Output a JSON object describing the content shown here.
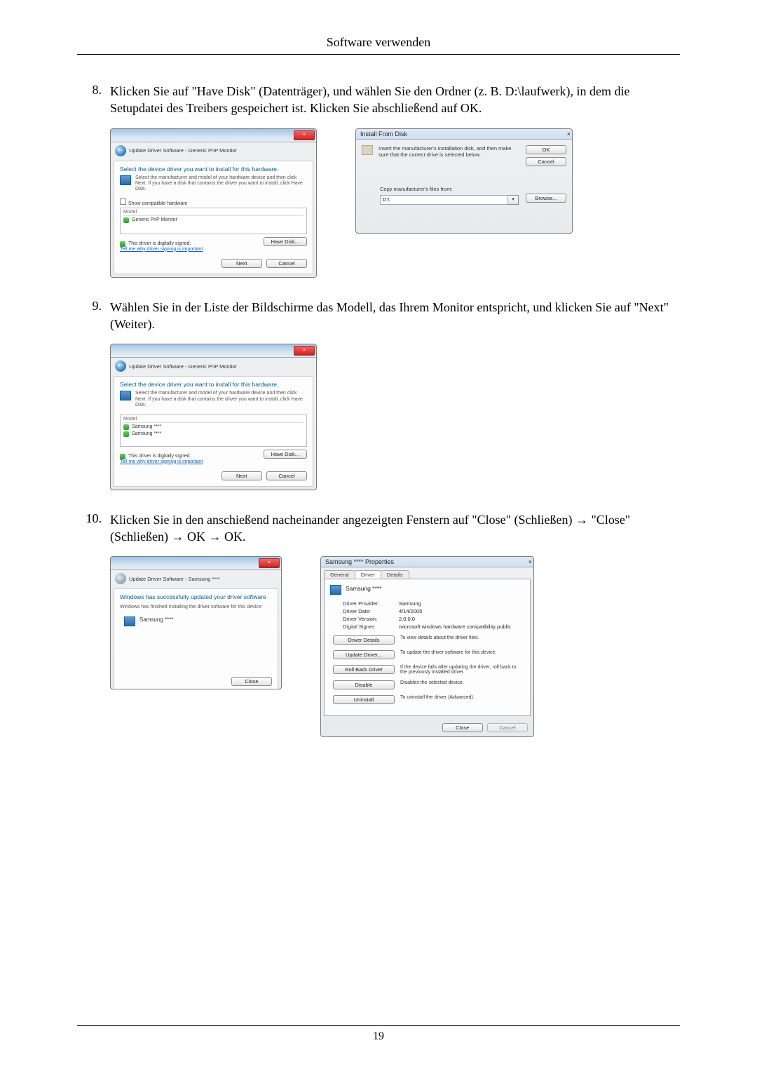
{
  "header": {
    "title": "Software verwenden"
  },
  "steps": {
    "s8": {
      "num": "8.",
      "text": "Klicken Sie auf \"Have Disk\" (Datenträger), und wählen Sie den Ordner (z. B. D:\\laufwerk), in dem die Setupdatei des Treibers gespeichert ist. Klicken Sie abschließend auf OK."
    },
    "s9": {
      "num": "9.",
      "text": "Wählen Sie in der Liste der Bildschirme das Modell, das Ihrem Monitor entspricht, und klicken Sie auf \"Next\" (Weiter)."
    },
    "s10": {
      "num": "10.",
      "text": "Klicken Sie in den anschießend nacheinander angezeigten Fenstern auf \"Close\" (Schließen) → \"Close\" (Schließen) → OK → OK."
    }
  },
  "dlg8a": {
    "crumb": "Update Driver Software - Generic PnP Monitor",
    "heading": "Select the device driver you want to install for this hardware.",
    "sub": "Select the manufacturer and model of your hardware device and then click Next. If you have a disk that contains the driver you want to install, click Have Disk.",
    "chk": "Show compatible hardware",
    "list_header": "Model",
    "list_item": "Generic PnP Monitor",
    "signed": "This driver is digitally signed.",
    "signed_link": "Tell me why driver signing is important",
    "btn_have_disk": "Have Disk...",
    "btn_next": "Next",
    "btn_cancel": "Cancel"
  },
  "dlg8b": {
    "title": "Install From Disk",
    "text": "Insert the manufacturer's installation disk, and then make sure that the correct drive is selected below.",
    "btn_ok": "OK",
    "btn_cancel": "Cancel",
    "copy_label": "Copy manufacturer's files from:",
    "path": "D:\\",
    "btn_browse": "Browse..."
  },
  "dlg9": {
    "crumb": "Update Driver Software - Generic PnP Monitor",
    "heading": "Select the device driver you want to install for this hardware.",
    "sub": "Select the manufacturer and model of your hardware device and then click Next. If you have a disk that contains the driver you want to install, click Have Disk.",
    "list_header": "Model",
    "item1": "Samsung ****",
    "item2": "Samsung ****",
    "signed": "This driver is digitally signed.",
    "signed_link": "Tell me why driver signing is important",
    "btn_have_disk": "Have Disk...",
    "btn_next": "Next",
    "btn_cancel": "Cancel"
  },
  "dlg10a": {
    "crumb": "Update Driver Software - Samsung ****",
    "heading": "Windows has successfully updated your driver software",
    "sub": "Windows has finished installing the driver software for this device:",
    "device": "Samsung ****",
    "btn_close": "Close"
  },
  "dlg10b": {
    "title": "Samsung **** Properties",
    "tabs": {
      "general": "General",
      "driver": "Driver",
      "details": "Details"
    },
    "device": "Samsung ****",
    "rows": {
      "provider_k": "Driver Provider:",
      "provider_v": "Samsung",
      "date_k": "Driver Date:",
      "date_v": "4/14/2005",
      "ver_k": "Driver Version:",
      "ver_v": "2.0.0.0",
      "signer_k": "Digital Signer:",
      "signer_v": "microsoft windows hardware compatibility publis"
    },
    "actions": {
      "details_btn": "Driver Details",
      "details_d": "To view details about the driver files.",
      "update_btn": "Update Driver...",
      "update_d": "To update the driver software for this device.",
      "roll_btn": "Roll Back Driver",
      "roll_d": "If the device fails after updating the driver, roll back to the previously installed driver.",
      "disable_btn": "Disable",
      "disable_d": "Disables the selected device.",
      "uninstall_btn": "Uninstall",
      "uninstall_d": "To uninstall the driver (Advanced)."
    },
    "btn_close": "Close",
    "btn_cancel": "Cancel"
  },
  "footer": {
    "page": "19"
  }
}
